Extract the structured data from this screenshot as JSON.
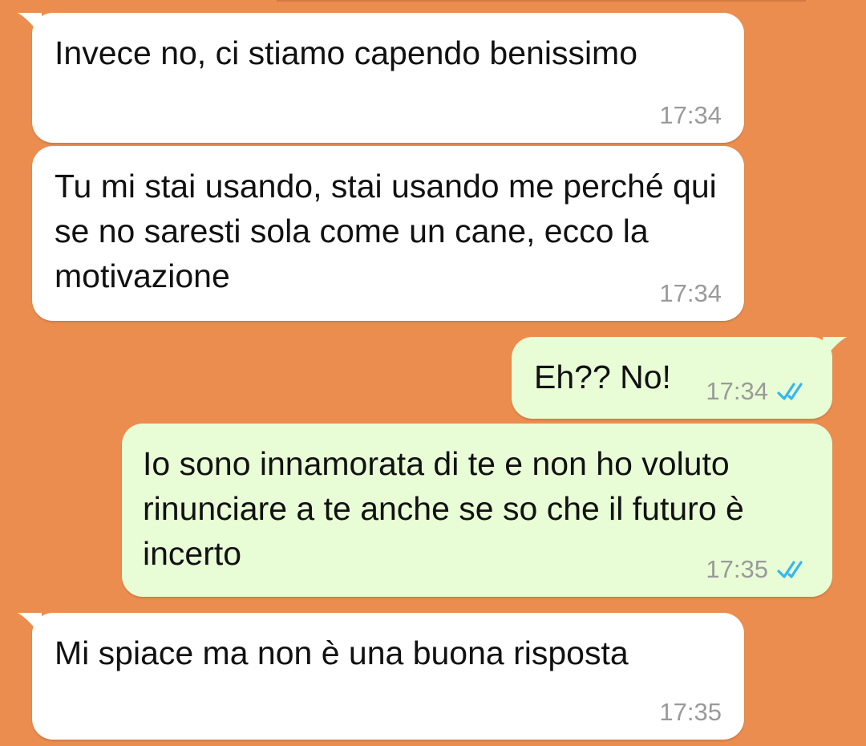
{
  "messages": [
    {
      "direction": "incoming",
      "text": "Invece no, ci stiamo capendo benissimo",
      "time": "17:34"
    },
    {
      "direction": "incoming",
      "text": "Tu mi stai usando, stai usando me perché qui se no saresti sola come un cane, ecco la motivazione",
      "time": "17:34"
    },
    {
      "direction": "outgoing",
      "text": "Eh?? No!",
      "time": "17:34",
      "status_icon": "double-check-read-icon"
    },
    {
      "direction": "outgoing",
      "text": "Io sono innamorata di te e non ho voluto rinunciare a te anche se so che il futuro è incerto",
      "time": "17:35",
      "status_icon": "double-check-read-icon"
    },
    {
      "direction": "incoming",
      "text": "Mi spiace ma non è una buona risposta",
      "time": "17:35"
    }
  ],
  "colors": {
    "chat_background": "#ec8d50",
    "incoming_bubble": "#ffffff",
    "outgoing_bubble": "#e8fcd6",
    "timestamp": "#9a9a9a",
    "read_tick": "#34b7f1"
  }
}
